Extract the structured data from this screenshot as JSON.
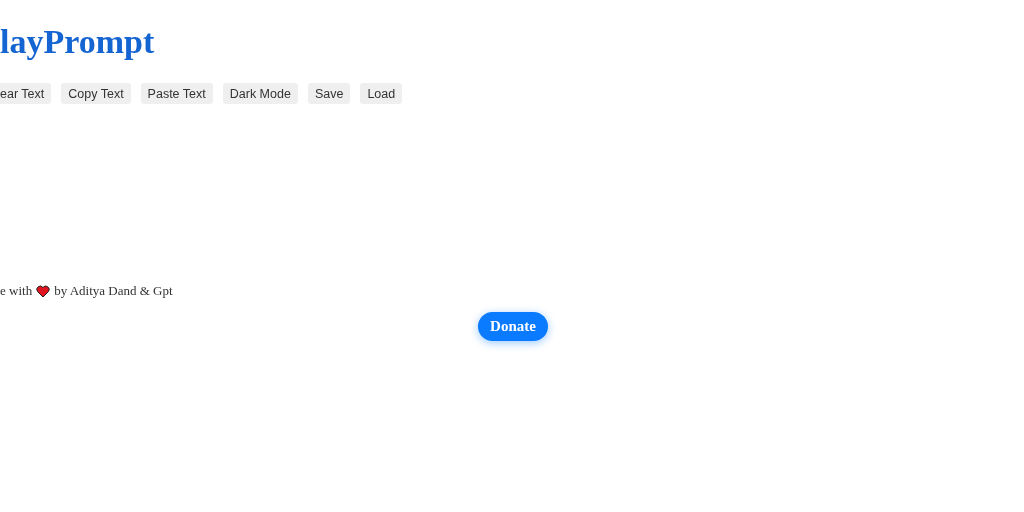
{
  "title": "layPrompt",
  "buttons": [
    "ear Text",
    "Copy Text",
    "Paste Text",
    "Dark Mode",
    "Save",
    "Load"
  ],
  "footer": {
    "before": "e with",
    "after": "by Aditya Dand & Gpt"
  },
  "donate": "Donate"
}
